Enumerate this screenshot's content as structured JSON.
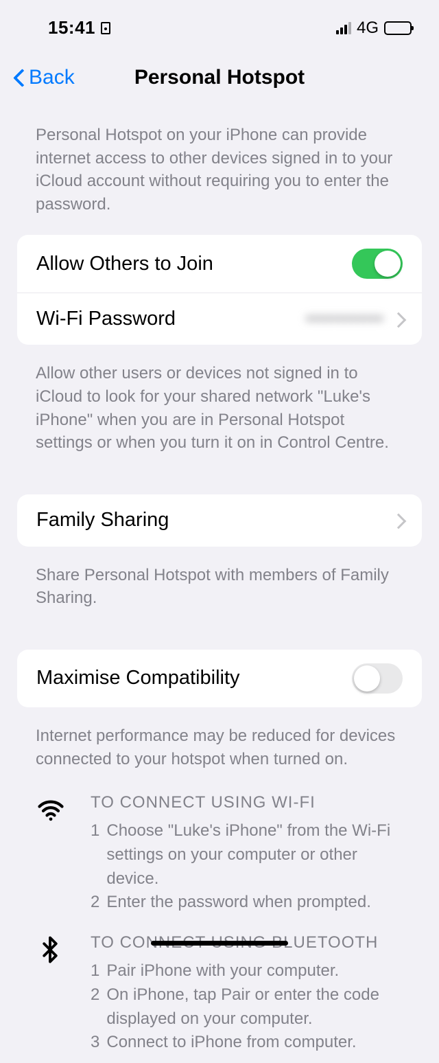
{
  "status": {
    "time": "15:41",
    "network": "4G"
  },
  "nav": {
    "back": "Back",
    "title": "Personal Hotspot"
  },
  "notes": {
    "intro": "Personal Hotspot on your iPhone can provide internet access to other devices signed in to your iCloud account without requiring you to enter the password.",
    "allow": "Allow other users or devices not signed in to iCloud to look for your shared network \"Luke's iPhone\" when you are in Personal Hotspot settings or when you turn it on in Control Centre.",
    "family": "Share Personal Hotspot with members of Family Sharing.",
    "compat": "Internet performance may be reduced for devices connected to your hotspot when turned on."
  },
  "rows": {
    "allow_label": "Allow Others to Join",
    "allow_on": true,
    "wifi_label": "Wi-Fi Password",
    "wifi_value": "••••••••••••",
    "family_label": "Family Sharing",
    "compat_label": "Maximise Compatibility",
    "compat_on": false
  },
  "instructions": {
    "wifi": {
      "head": "TO CONNECT USING WI-FI",
      "steps": [
        "Choose \"Luke's iPhone\" from the Wi-Fi settings on your computer or other device.",
        "Enter the password when prompted."
      ]
    },
    "bt": {
      "head": "TO CONNECT USING BLUETOOTH",
      "steps": [
        "Pair iPhone with your computer.",
        "On iPhone, tap Pair or enter the code displayed on your computer.",
        "Connect to iPhone from computer."
      ]
    }
  }
}
